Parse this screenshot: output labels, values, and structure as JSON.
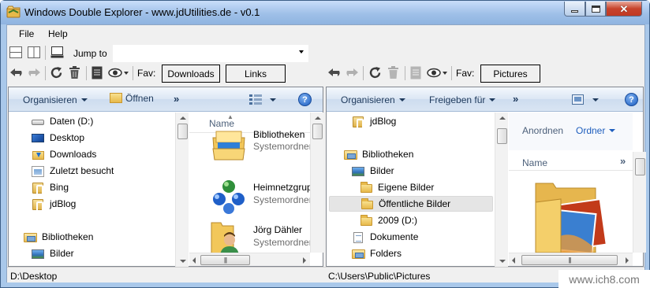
{
  "window": {
    "title": "Windows Double Explorer - www.jdUtilities.de - v0.1"
  },
  "menu": [
    "File",
    "Help"
  ],
  "toolbar": {
    "jump_label": "Jump to",
    "jump_value": "",
    "fav_label": "Fav:"
  },
  "left_toolbar": {
    "favorites": [
      "Downloads",
      "Links"
    ]
  },
  "right_toolbar": {
    "favorites": [
      "Pictures"
    ]
  },
  "left_pane": {
    "cmd": {
      "organize": "Organisieren",
      "open": "Öffnen",
      "more": "»"
    },
    "tree": [
      {
        "icon": "drive-icon",
        "label": "Daten (D:)"
      },
      {
        "icon": "desktop-icon",
        "label": "Desktop"
      },
      {
        "icon": "downloads-folder-icon",
        "label": "Downloads"
      },
      {
        "icon": "recent-places-icon",
        "label": "Zuletzt besucht"
      },
      {
        "icon": "favorite-link-icon",
        "label": "Bing"
      },
      {
        "icon": "favorite-link-icon",
        "label": "jdBlog"
      },
      {
        "icon": "libraries-icon",
        "label": "Bibliotheken"
      },
      {
        "icon": "pictures-icon",
        "label": "Bilder"
      }
    ],
    "column_header": "Name",
    "items": [
      {
        "icon": "libraries-icon",
        "name": "Bibliotheken",
        "type": "Systemordner"
      },
      {
        "icon": "homegroup-icon",
        "name": "Heimnetzgruppe",
        "type": "Systemordner"
      },
      {
        "icon": "user-folder-icon",
        "name": "Jörg Dähler",
        "type": "Systemordner"
      }
    ],
    "status": "D:\\Desktop"
  },
  "right_pane": {
    "cmd": {
      "organize": "Organisieren",
      "share": "Freigeben für",
      "more": "»"
    },
    "tree": [
      {
        "icon": "favorite-link-icon",
        "label": "jdBlog"
      },
      {
        "icon": "libraries-icon",
        "label": "Bibliotheken"
      },
      {
        "icon": "pictures-icon",
        "label": "Bilder"
      },
      {
        "icon": "folder-icon",
        "label": "Eigene Bilder"
      },
      {
        "icon": "folder-icon",
        "label": "Öffentliche Bilder"
      },
      {
        "icon": "folder-icon",
        "label": "2009 (D:)"
      },
      {
        "icon": "documents-icon",
        "label": "Dokumente"
      },
      {
        "icon": "libraries-icon",
        "label": "Folders"
      }
    ],
    "arrange_label": "Anordnen",
    "arrange_value": "Ordner",
    "column_header": "Name",
    "more": "»",
    "status": "C:\\Users\\Public\\Pictures"
  },
  "watermark": "www.ich8.com",
  "colors": {
    "title_bar": "#9fc0e8",
    "command_text": "#1e395b",
    "selection": "#e5e5e5",
    "close_button": "#c7432c"
  }
}
